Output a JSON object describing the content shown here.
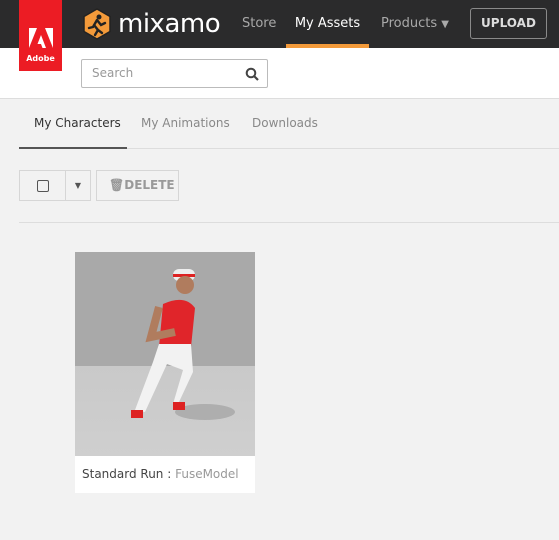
{
  "header": {
    "brand": "mixamo",
    "adobe_label": "Adobe",
    "nav": [
      {
        "label": "Store"
      },
      {
        "label": "My Assets",
        "active": true
      },
      {
        "label": "Products"
      }
    ],
    "upload_label": "UPLOAD",
    "accent": "#f39a3a"
  },
  "search": {
    "placeholder": "Search"
  },
  "tabs": [
    {
      "label": "My Characters",
      "active": true
    },
    {
      "label": "My Animations"
    },
    {
      "label": "Downloads"
    }
  ],
  "toolbar": {
    "delete_label": "DELETE"
  },
  "assets": [
    {
      "name": "Standard Run",
      "separator": " : ",
      "character": "FuseModel"
    }
  ]
}
